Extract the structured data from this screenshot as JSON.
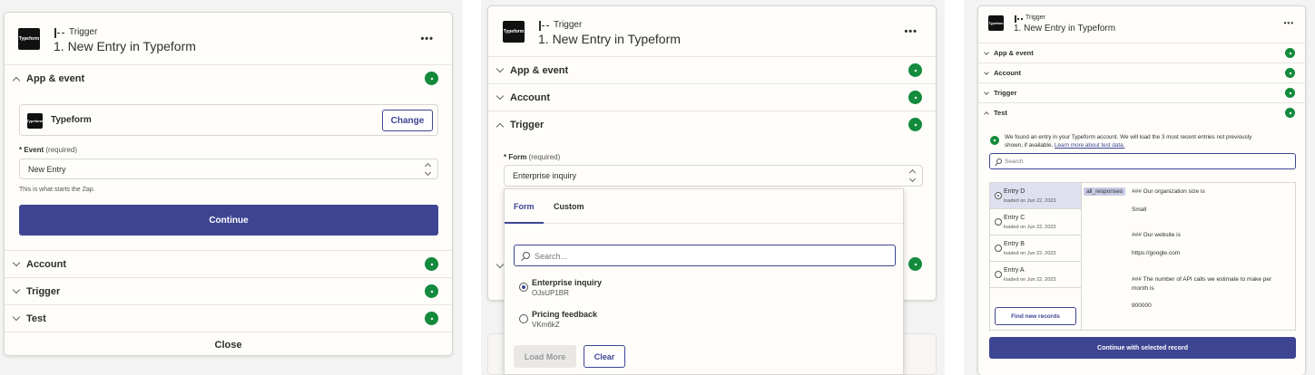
{
  "panel1": {
    "trigger_label": "Trigger",
    "title": "1. New Entry in Typeform",
    "more_icon": "•••",
    "logo_text": "Typeform",
    "sections": {
      "app_event": "App & event",
      "account": "Account",
      "trigger": "Trigger",
      "test": "Test"
    },
    "app_name": "Typeform",
    "change_label": "Change",
    "event_label": "* Event",
    "event_required": "(required)",
    "event_value": "New Entry",
    "helper": "This is what starts the Zap.",
    "continue_label": "Continue",
    "close_label": "Close"
  },
  "panel2": {
    "trigger_label": "Trigger",
    "title": "1. New Entry in Typeform",
    "more_icon": "•••",
    "logo_text": "Typeform",
    "sections": {
      "app_event": "App & event",
      "account": "Account",
      "trigger": "Trigger"
    },
    "form_label": "* Form",
    "form_required": "(required)",
    "form_value": "Enterprise inquiry",
    "tabs": [
      "Form",
      "Custom"
    ],
    "search_placeholder": "Search...",
    "options": [
      {
        "name": "Enterprise inquiry",
        "id": "OJsUP1BR",
        "selected": true
      },
      {
        "name": "Pricing feedback",
        "id": "VKm6kZ",
        "selected": false
      }
    ],
    "load_more_label": "Load More",
    "clear_label": "Clear"
  },
  "panel3": {
    "trigger_label": "Trigger",
    "title": "1. New Entry in Typeform",
    "more_icon": "•••",
    "logo_text": "Typeform",
    "sections": {
      "app_event": "App & event",
      "account": "Account",
      "trigger": "Trigger",
      "test": "Test"
    },
    "found_text_1": "We found an entry in your Typeform account. We will load the 3 most recent entries not previously",
    "found_text_2": "shown, if available.",
    "learn_more": "Learn more about test data.",
    "search_placeholder": "Search",
    "entries": [
      {
        "name": "Entry D",
        "date": "loaded on Jun 22, 2023",
        "selected": true
      },
      {
        "name": "Entry C",
        "date": "loaded on Jun 22, 2023",
        "selected": false
      },
      {
        "name": "Entry B",
        "date": "loaded on Jun 22, 2023",
        "selected": false
      },
      {
        "name": "Entry A",
        "date": "loaded on Jun 22, 2023",
        "selected": false
      }
    ],
    "find_new_label": "Find new records",
    "field_tag": "all_responses",
    "record_lines": [
      "### Our organization size is",
      "Small",
      "### Our website is",
      "https://google.com",
      "### The number of API calls we estimate to make per",
      "month is",
      "900000"
    ],
    "continue_label": "Continue with selected record"
  }
}
